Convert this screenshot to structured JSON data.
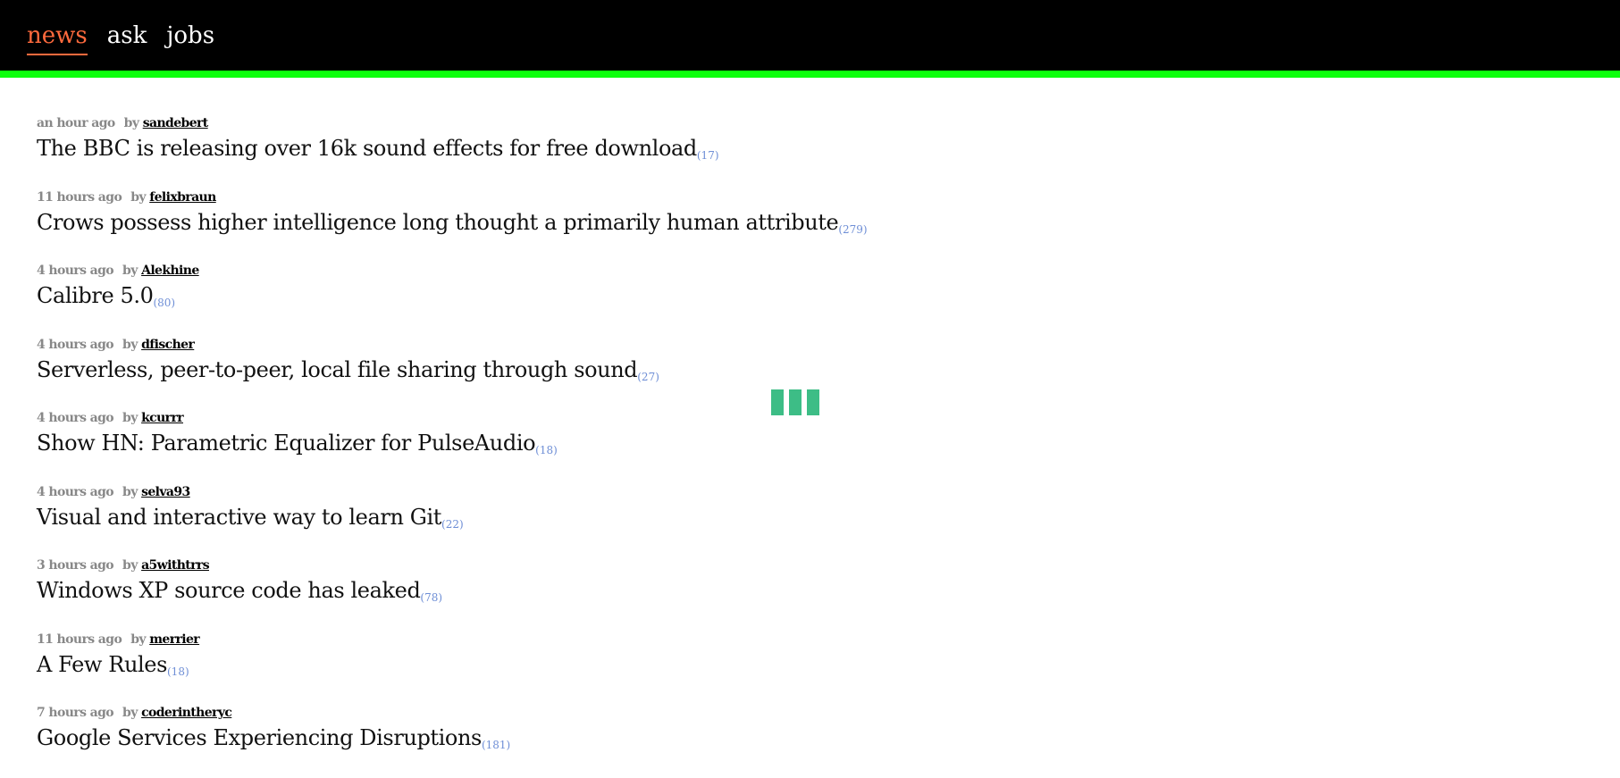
{
  "nav": {
    "items": [
      {
        "label": "news",
        "active": true
      },
      {
        "label": "ask",
        "active": false
      },
      {
        "label": "jobs",
        "active": false
      }
    ]
  },
  "colors": {
    "topbar": "#000000",
    "accent_line": "#0dff0d",
    "active_nav": "#ff6a3d",
    "comment_link": "#6f8fd6",
    "loader": "#3dbd86"
  },
  "loader": {
    "icon": "loading-bars-icon"
  },
  "stories": [
    {
      "time": "an hour ago",
      "by": "by",
      "user": "sandebert",
      "title": "The BBC is releasing over 16k sound effects for free download",
      "comments": "(17)"
    },
    {
      "time": "11 hours ago",
      "by": "by",
      "user": "felixbraun",
      "title": "Crows possess higher intelligence long thought a primarily human attribute",
      "comments": "(279)"
    },
    {
      "time": "4 hours ago",
      "by": "by",
      "user": "Alekhine",
      "title": "Calibre 5.0",
      "comments": "(80)"
    },
    {
      "time": "4 hours ago",
      "by": "by",
      "user": "dfischer",
      "title": "Serverless, peer-to-peer, local file sharing through sound",
      "comments": "(27)"
    },
    {
      "time": "4 hours ago",
      "by": "by",
      "user": "kcurrr",
      "title": "Show HN: Parametric Equalizer for PulseAudio",
      "comments": "(18)"
    },
    {
      "time": "4 hours ago",
      "by": "by",
      "user": "selva93",
      "title": "Visual and interactive way to learn Git",
      "comments": "(22)"
    },
    {
      "time": "3 hours ago",
      "by": "by",
      "user": "a5withtrrs",
      "title": "Windows XP source code has leaked",
      "comments": "(78)"
    },
    {
      "time": "11 hours ago",
      "by": "by",
      "user": "merrier",
      "title": "A Few Rules",
      "comments": "(18)"
    },
    {
      "time": "7 hours ago",
      "by": "by",
      "user": "coderintheryc",
      "title": "Google Services Experiencing Disruptions",
      "comments": "(181)"
    }
  ]
}
